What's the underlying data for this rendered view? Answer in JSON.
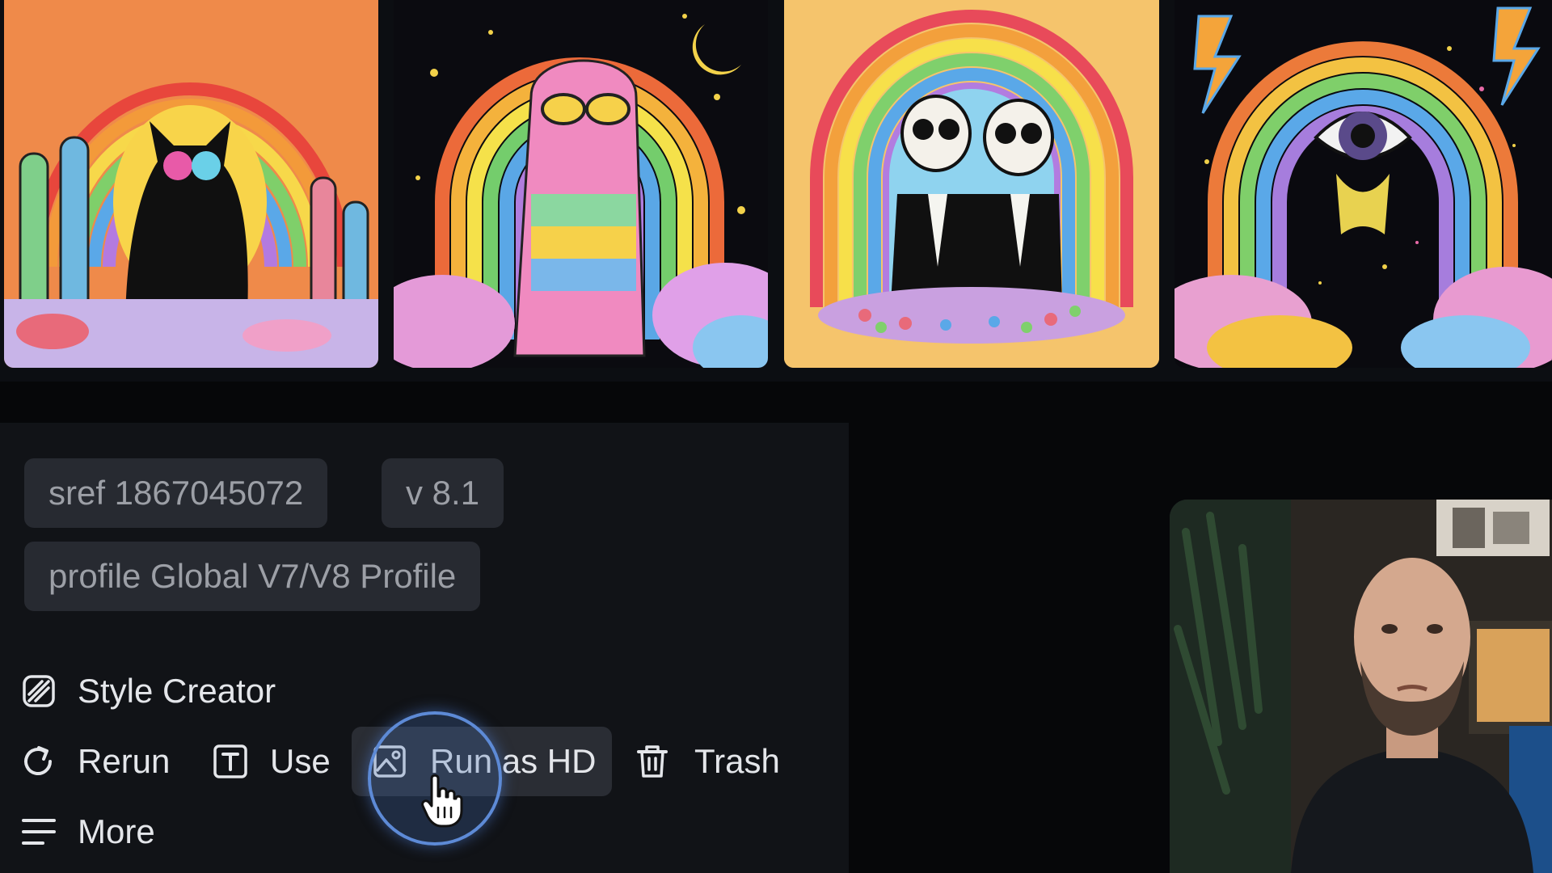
{
  "gallery": {
    "images": [
      {
        "icon": "rainbow-cat-image"
      },
      {
        "icon": "rainbow-figure-image"
      },
      {
        "icon": "rainbow-skeletons-image"
      },
      {
        "icon": "rainbow-eye-image"
      }
    ]
  },
  "params": {
    "sref_label": "sref 1867045072",
    "version_label": "v 8.1",
    "profile_label": "profile Global V7/V8 Profile"
  },
  "actions": {
    "style_creator": "Style Creator",
    "rerun": "Rerun",
    "use": "Use",
    "run_as_hd": "Run as HD",
    "trash": "Trash",
    "more": "More"
  },
  "colors": {
    "background": "#060709",
    "panel": "#111317",
    "chip": "#272a31",
    "chip_text": "#9c9fa6",
    "action_text": "#e4e6ea",
    "cursor_ring": "#5d8ad6"
  }
}
